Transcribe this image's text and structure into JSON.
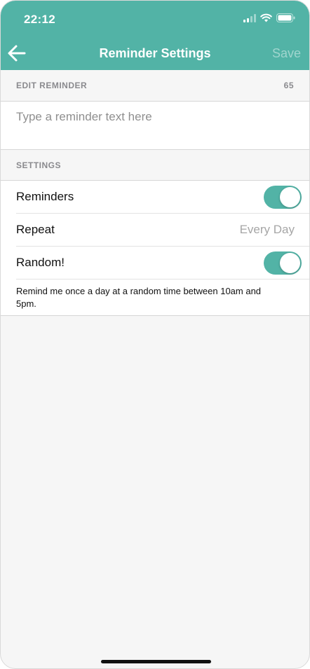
{
  "status_bar": {
    "time": "22:12"
  },
  "nav": {
    "back_icon": "arrow-left-icon",
    "title": "Reminder Settings",
    "save_label": "Save"
  },
  "edit_reminder": {
    "header": "EDIT REMINDER",
    "char_count": "65",
    "placeholder": "Type a reminder text here",
    "value": ""
  },
  "settings": {
    "header": "SETTINGS",
    "rows": [
      {
        "label": "Reminders",
        "type": "toggle",
        "on": true
      },
      {
        "label": "Repeat",
        "type": "value",
        "value": "Every Day"
      },
      {
        "label": "Random!",
        "type": "toggle",
        "on": true
      }
    ],
    "note": "Remind me once a day at a random time between 10am and 5pm."
  },
  "colors": {
    "accent": "#52b3a6",
    "background": "#f6f6f6",
    "section_text": "#8a8a8e"
  }
}
